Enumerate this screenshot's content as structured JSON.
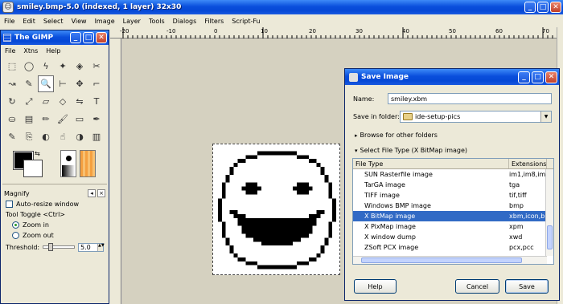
{
  "window": {
    "title": "smiley.bmp-5.0 (indexed, 1 layer) 32x30",
    "controls": [
      "_",
      "□",
      "✕"
    ]
  },
  "menubar": [
    "File",
    "Edit",
    "Select",
    "View",
    "Image",
    "Layer",
    "Tools",
    "Dialogs",
    "Filters",
    "Script-Fu"
  ],
  "ruler": {
    "ticks": [
      "-20",
      "-10",
      "0",
      "10",
      "20",
      "30",
      "40",
      "50",
      "60",
      "70"
    ]
  },
  "toolbox": {
    "title": "The GIMP",
    "menu": [
      "File",
      "Xtns",
      "Help"
    ],
    "tools": [
      "rect-select-icon",
      "ellipse-select-icon",
      "lasso-icon",
      "magic-wand-icon",
      "color-select-icon",
      "scissors-icon",
      "paths-icon",
      "color-picker-icon",
      "zoom-icon",
      "measure-icon",
      "move-icon",
      "crop-icon",
      "rotate-icon",
      "scale-icon",
      "shear-icon",
      "perspective-icon",
      "flip-icon",
      "text-icon",
      "bucket-fill-icon",
      "blend-icon",
      "pencil-icon",
      "paintbrush-icon",
      "eraser-icon",
      "airbrush-icon",
      "ink-icon",
      "clone-icon",
      "convolve-icon",
      "smudge-icon",
      "dodge-burn-icon",
      "gradient-editor-icon"
    ],
    "selected_tool_index": 8,
    "options": {
      "title": "Magnify",
      "auto_resize_label": "Auto-resize window",
      "tool_toggle_label": "Tool Toggle  <Ctrl>",
      "zoom_in_label": "Zoom in",
      "zoom_out_label": "Zoom out",
      "threshold_label": "Threshold:",
      "threshold_value": "5.0"
    }
  },
  "dialog": {
    "title": "Save Image",
    "name_label": "Name:",
    "name_value": "smiley.xbm",
    "folder_label": "Save in folder:",
    "folder_value": "ide-setup-pics",
    "browse_label": "Browse for other folders",
    "filetype_label": "Select File Type (X BitMap image)",
    "columns": [
      "File Type",
      "Extensions"
    ],
    "rows": [
      {
        "type": "SUN Rasterfile image",
        "ext": "im1,im8,im"
      },
      {
        "type": "TarGA image",
        "ext": "tga"
      },
      {
        "type": "TIFF image",
        "ext": "tif,tiff"
      },
      {
        "type": "Windows BMP image",
        "ext": "bmp"
      },
      {
        "type": "X BitMap image",
        "ext": "xbm,icon,b"
      },
      {
        "type": "X PixMap image",
        "ext": "xpm"
      },
      {
        "type": "X window dump",
        "ext": "xwd"
      },
      {
        "type": "ZSoft PCX image",
        "ext": "pcx,pcc"
      }
    ],
    "selected_row": 4,
    "help_label": "Help",
    "cancel_label": "Cancel",
    "save_label": "Save"
  },
  "colors": {
    "titlebar": "#0a4fdc",
    "selection": "#316ac5"
  }
}
